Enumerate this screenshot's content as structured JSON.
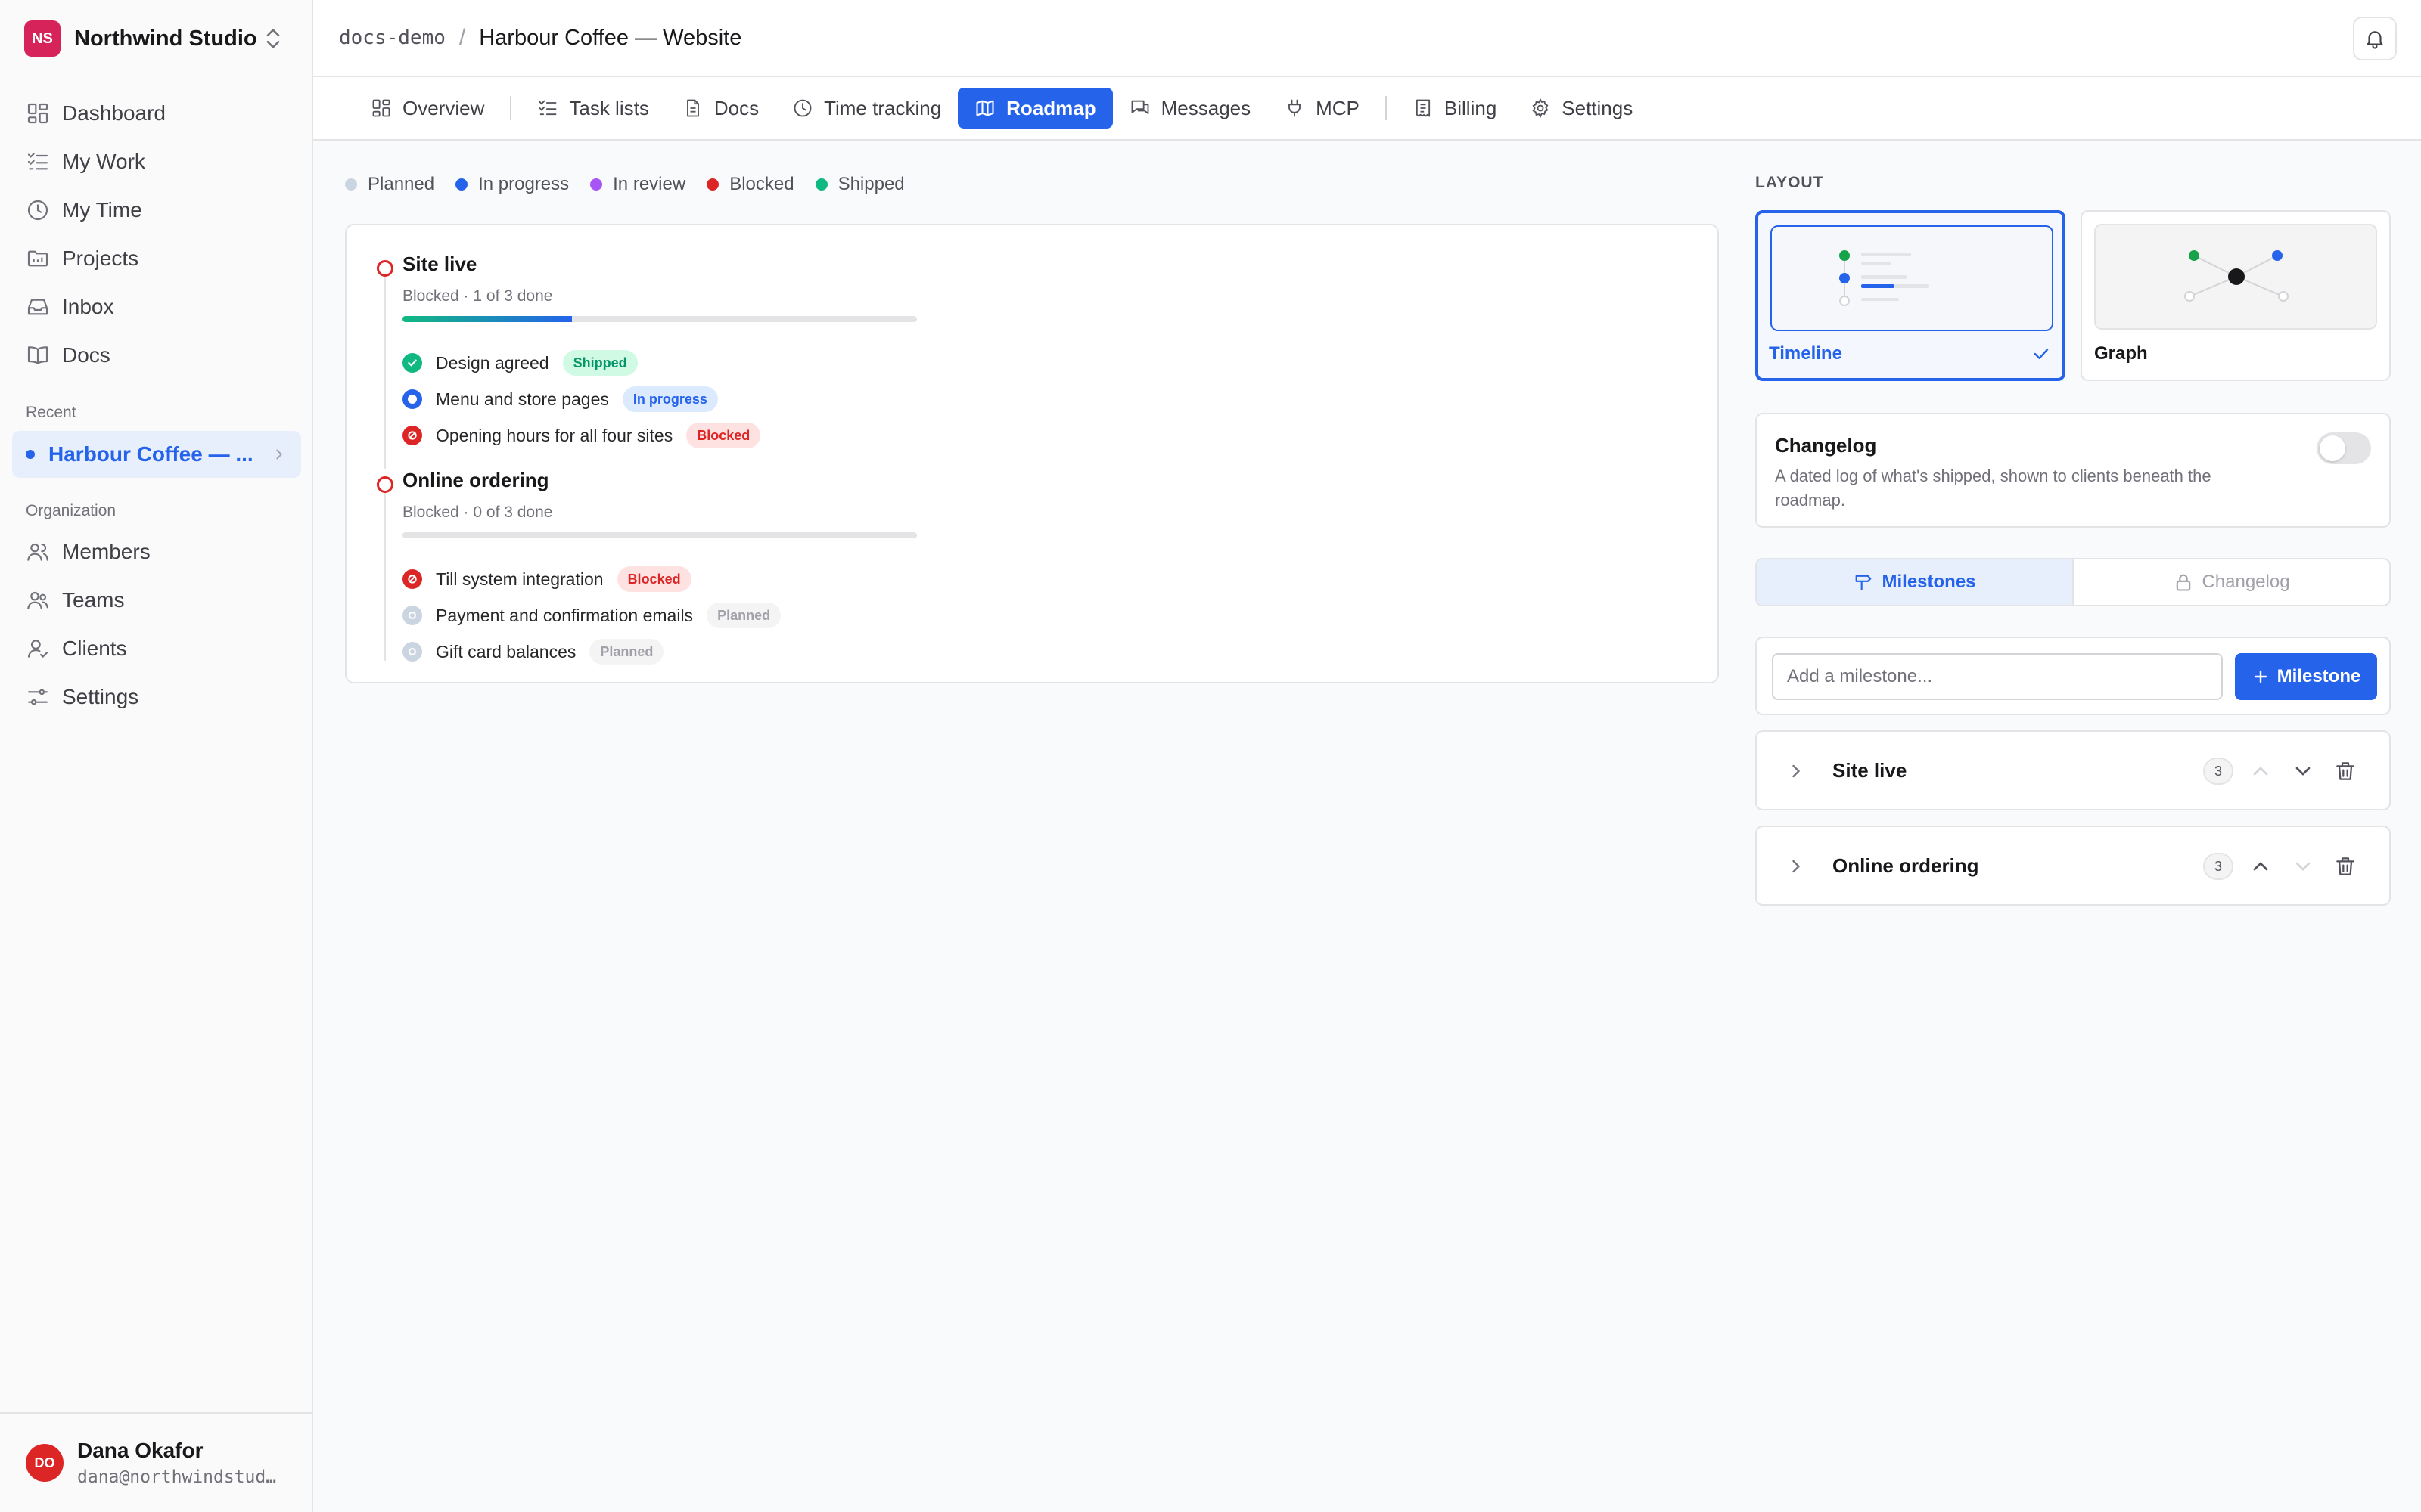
{
  "workspace": {
    "initials": "NS",
    "name": "Northwind Studio"
  },
  "sidebar": {
    "nav": [
      {
        "label": "Dashboard",
        "icon": "dashboard-icon"
      },
      {
        "label": "My Work",
        "icon": "checklist-icon"
      },
      {
        "label": "My Time",
        "icon": "clock-icon"
      },
      {
        "label": "Projects",
        "icon": "folder-icon"
      },
      {
        "label": "Inbox",
        "icon": "inbox-icon"
      },
      {
        "label": "Docs",
        "icon": "book-icon"
      }
    ],
    "recent_label": "Recent",
    "recent_item": "Harbour Coffee — ...",
    "org_label": "Organization",
    "org_nav": [
      {
        "label": "Members",
        "icon": "users-icon"
      },
      {
        "label": "Teams",
        "icon": "team-icon"
      },
      {
        "label": "Clients",
        "icon": "client-icon"
      },
      {
        "label": "Settings",
        "icon": "sliders-icon"
      }
    ]
  },
  "user": {
    "initials": "DO",
    "name": "Dana Okafor",
    "email": "dana@northwindstud…"
  },
  "breadcrumb": {
    "org": "docs-demo",
    "sep": "/",
    "project": "Harbour Coffee — Website"
  },
  "tabs": [
    {
      "label": "Overview",
      "icon": "grid-icon"
    },
    {
      "label": "Task lists",
      "icon": "list-icon"
    },
    {
      "label": "Docs",
      "icon": "document-icon"
    },
    {
      "label": "Time tracking",
      "icon": "clock-icon"
    },
    {
      "label": "Roadmap",
      "icon": "map-icon",
      "active": true
    },
    {
      "label": "Messages",
      "icon": "chat-icon"
    },
    {
      "label": "MCP",
      "icon": "plug-icon"
    },
    {
      "label": "Billing",
      "icon": "receipt-icon"
    },
    {
      "label": "Settings",
      "icon": "gear-icon"
    }
  ],
  "legend": [
    {
      "label": "Planned",
      "color": "#cbd5e1"
    },
    {
      "label": "In progress",
      "color": "#2563eb"
    },
    {
      "label": "In review",
      "color": "#a855f7"
    },
    {
      "label": "Blocked",
      "color": "#dc2626"
    },
    {
      "label": "Shipped",
      "color": "#10b981"
    }
  ],
  "timeline": {
    "milestones": [
      {
        "title": "Site live",
        "subtitle": "Blocked · 1 of 3 done",
        "progress": 0.33,
        "tasks": [
          {
            "label": "Design agreed",
            "status": "Shipped"
          },
          {
            "label": "Menu and store pages",
            "status": "In progress"
          },
          {
            "label": "Opening hours for all four sites",
            "status": "Blocked"
          }
        ]
      },
      {
        "title": "Online ordering",
        "subtitle": "Blocked · 0 of 3 done",
        "progress": 0,
        "tasks": [
          {
            "label": "Till system integration",
            "status": "Blocked"
          },
          {
            "label": "Payment and confirmation emails",
            "status": "Planned"
          },
          {
            "label": "Gift card balances",
            "status": "Planned"
          }
        ]
      }
    ]
  },
  "panel": {
    "layout_label": "LAYOUT",
    "layouts": [
      {
        "label": "Timeline",
        "selected": true
      },
      {
        "label": "Graph",
        "selected": false
      }
    ],
    "changelog": {
      "title": "Changelog",
      "description": "A dated log of what's shipped, shown to clients beneath the roadmap.",
      "enabled": false
    },
    "segments": [
      {
        "label": "Milestones",
        "icon": "signpost-icon",
        "active": true
      },
      {
        "label": "Changelog",
        "icon": "lock-icon",
        "active": false
      }
    ],
    "add": {
      "placeholder": "Add a milestone...",
      "button": "Milestone"
    },
    "milestone_rows": [
      {
        "title": "Site live",
        "count": "3"
      },
      {
        "title": "Online ordering",
        "count": "3"
      }
    ]
  }
}
